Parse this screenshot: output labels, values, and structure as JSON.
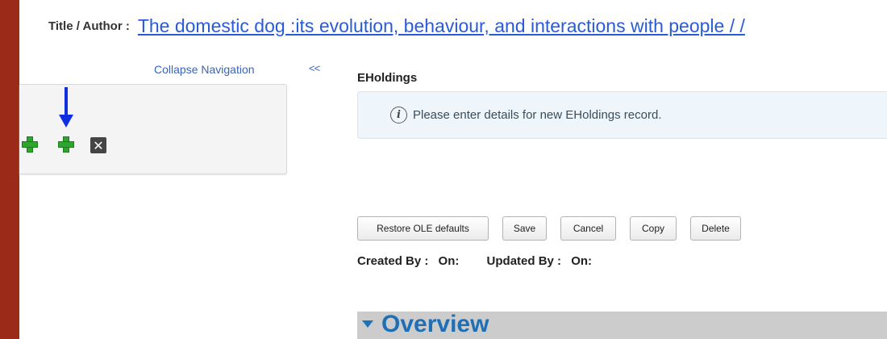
{
  "colors": {
    "left_bar": "#9b2a18",
    "link": "#2a5bd7",
    "plus": "#2fa52f",
    "arrow": "#1030e0",
    "info_bg": "#eef6fb",
    "overview_bar": "#cccccc",
    "overview_text": "#1e6fb3"
  },
  "header": {
    "label": "Title / Author :",
    "title_link": "The domestic dog :its evolution, behaviour, and interactions with people / /"
  },
  "navigation": {
    "collapse_label": "Collapse Navigation",
    "collapse_chevron": "<<",
    "tools": [
      {
        "icon": "plus-icon"
      },
      {
        "icon": "plus-icon"
      },
      {
        "icon": "close-icon",
        "glyph": "✕"
      }
    ],
    "pointer": "arrow-down-icon"
  },
  "main": {
    "section_title": "EHoldings",
    "info_icon": "info-icon",
    "info_glyph": "i",
    "info_message": "Please enter details for new EHoldings record.",
    "buttons": {
      "restore": "Restore OLE defaults",
      "save": "Save",
      "cancel": "Cancel",
      "copy": "Copy",
      "delete": "Delete"
    },
    "meta": {
      "created_by": "Created By :",
      "created_on": "On:",
      "updated_by": "Updated By :",
      "updated_on": "On:"
    },
    "overview_title": "Overview"
  }
}
